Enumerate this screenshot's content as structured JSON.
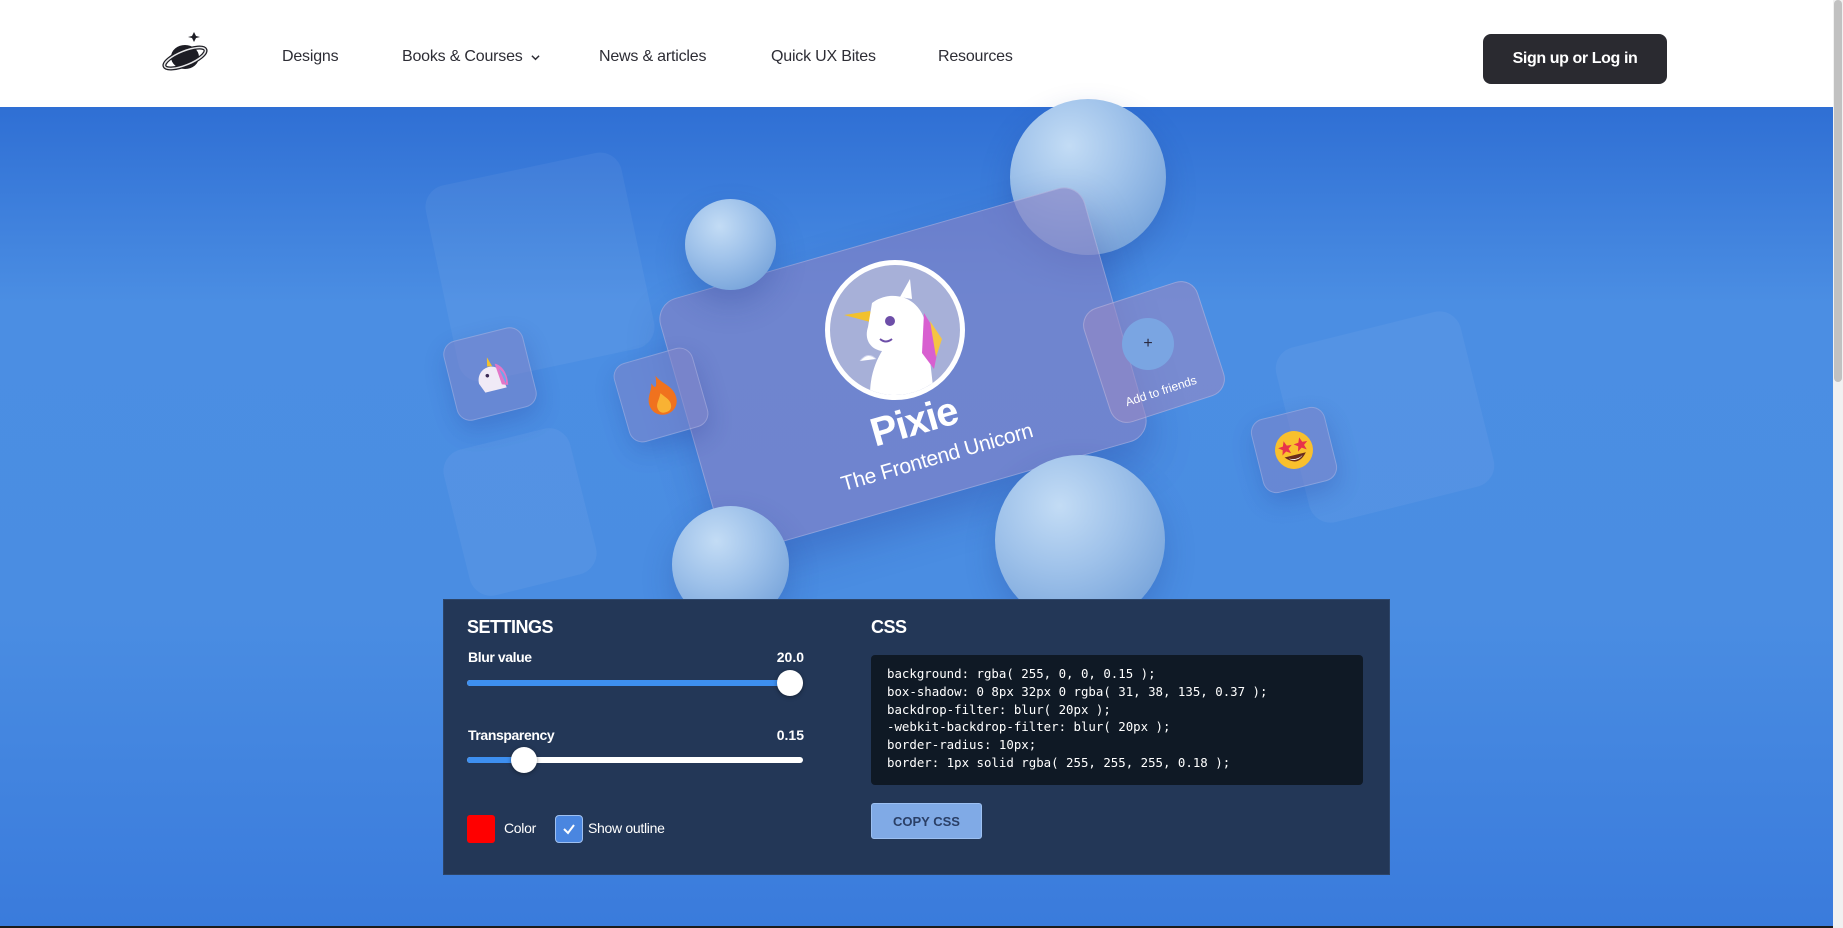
{
  "header": {
    "logo": "planet-logo",
    "nav": [
      {
        "label": "Designs",
        "dropdown": false
      },
      {
        "label": "Books & Courses",
        "dropdown": true
      },
      {
        "label": "News & articles",
        "dropdown": false
      },
      {
        "label": "Quick UX Bites",
        "dropdown": false
      },
      {
        "label": "Resources",
        "dropdown": false
      }
    ],
    "cta_label": "Sign up or Log in"
  },
  "hero": {
    "card": {
      "title": "Pixie",
      "subtitle": "The Frontend Unicorn",
      "avatar": "unicorn-avatar"
    },
    "add_friend": {
      "plus": "+",
      "label": "Add to friends"
    },
    "tiles": [
      "unicorn-emoji",
      "fire-emoji",
      "star-struck-emoji"
    ]
  },
  "settings": {
    "heading": "SETTINGS",
    "blur": {
      "label": "Blur value",
      "value": "20.0",
      "fraction": 0.96
    },
    "transparency": {
      "label": "Transparency",
      "value": "0.15",
      "fraction": 0.17
    },
    "color_label": "Color",
    "color_value": "#ff0000",
    "outline_label": "Show outline",
    "outline_checked": true
  },
  "css": {
    "heading": "CSS",
    "lines": [
      "background: rgba( 255, 0, 0, 0.15 );",
      "box-shadow: 0 8px 32px 0 rgba( 31, 38, 135, 0.37 );",
      "backdrop-filter: blur( 20px );",
      "-webkit-backdrop-filter: blur( 20px );",
      "border-radius: 10px;",
      "border: 1px solid rgba( 255, 255, 255, 0.18 );"
    ],
    "copy_label": "COPY CSS"
  },
  "colors": {
    "hero_blue": "#4a8de2",
    "panel_navy": "#233757",
    "slider_blue": "#3d8ff0",
    "cta_dark": "#2a2a30"
  }
}
